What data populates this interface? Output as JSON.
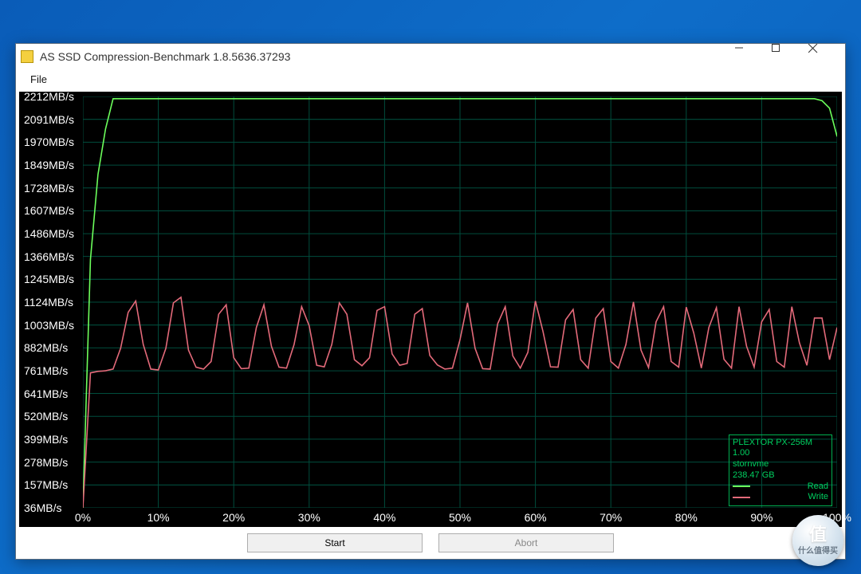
{
  "window": {
    "title": "AS SSD Compression-Benchmark 1.8.5636.37293"
  },
  "menu": {
    "file": "File"
  },
  "buttons": {
    "start": "Start",
    "abort": "Abort"
  },
  "legend": {
    "device": "PLEXTOR PX-256M",
    "fw": "1.00",
    "driver": "stornvme",
    "capacity": "238.47 GB",
    "read_label": "Read",
    "write_label": "Write",
    "read_color": "#6cff5c",
    "write_color": "#e46a7a"
  },
  "watermark": {
    "char": "值",
    "text": "什么值得买"
  },
  "chart_data": {
    "type": "line",
    "title": "",
    "xlabel": "",
    "ylabel": "",
    "y_unit": "MB/s",
    "xlim": [
      0,
      100
    ],
    "ylim": [
      36,
      2212
    ],
    "y_ticks": [
      36,
      157,
      278,
      399,
      520,
      641,
      761,
      882,
      1003,
      1124,
      1245,
      1366,
      1486,
      1607,
      1728,
      1849,
      1970,
      2091,
      2212
    ],
    "x_ticks": [
      0,
      10,
      20,
      30,
      40,
      50,
      60,
      70,
      80,
      90,
      100
    ],
    "x_tick_labels": [
      "0%",
      "10%",
      "20%",
      "30%",
      "40%",
      "50%",
      "60%",
      "70%",
      "80%",
      "90%",
      "100%"
    ],
    "series": [
      {
        "name": "Read",
        "color": "#6cff5c",
        "x": [
          0,
          1,
          2,
          3,
          4,
          97,
          98,
          99,
          100
        ],
        "values": [
          36,
          1350,
          1800,
          2040,
          2200,
          2200,
          2190,
          2150,
          2000
        ]
      },
      {
        "name": "Write",
        "color": "#e46a7a",
        "x": [
          0,
          1,
          2,
          3,
          4,
          5,
          6,
          7,
          8,
          9,
          10,
          11,
          12,
          13,
          14,
          15,
          16,
          17,
          18,
          19,
          20,
          21,
          22,
          23,
          24,
          25,
          26,
          27,
          28,
          29,
          30,
          31,
          32,
          33,
          34,
          35,
          36,
          37,
          38,
          39,
          40,
          41,
          42,
          43,
          44,
          45,
          46,
          47,
          48,
          49,
          50,
          51,
          52,
          53,
          54,
          55,
          56,
          57,
          58,
          59,
          60,
          61,
          62,
          63,
          64,
          65,
          66,
          67,
          68,
          69,
          70,
          71,
          72,
          73,
          74,
          75,
          76,
          77,
          78,
          79,
          80,
          81,
          82,
          83,
          84,
          85,
          86,
          87,
          88,
          89,
          90,
          91,
          92,
          93,
          94,
          95,
          96,
          97,
          98,
          99,
          100
        ],
        "values": [
          36,
          750,
          758,
          761,
          770,
          880,
          1070,
          1130,
          900,
          770,
          765,
          880,
          1120,
          1150,
          870,
          780,
          770,
          810,
          1060,
          1110,
          830,
          772,
          775,
          990,
          1110,
          890,
          780,
          775,
          900,
          1100,
          1000,
          790,
          782,
          900,
          1120,
          1060,
          820,
          788,
          830,
          1080,
          1100,
          850,
          790,
          800,
          1060,
          1090,
          842,
          792,
          770,
          775,
          925,
          1120,
          880,
          772,
          770,
          1010,
          1100,
          840,
          775,
          858,
          1130,
          970,
          782,
          780,
          1030,
          1085,
          820,
          775,
          1040,
          1090,
          810,
          775,
          900,
          1125,
          870,
          778,
          1020,
          1100,
          810,
          780,
          1098,
          960,
          775,
          990,
          1095,
          822,
          775,
          1100,
          890,
          780,
          1020,
          1085,
          810,
          780,
          1100,
          910,
          790,
          1040,
          1040,
          820,
          990
        ]
      }
    ]
  }
}
